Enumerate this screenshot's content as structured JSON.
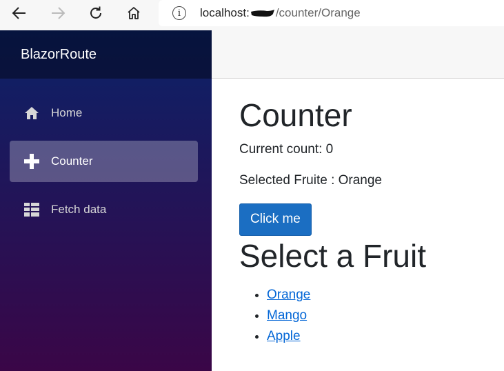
{
  "browser": {
    "url_host": "localhost:",
    "url_path": "/counter/Orange"
  },
  "sidebar": {
    "brand": "BlazorRoute",
    "items": [
      {
        "label": "Home",
        "icon": "home-icon",
        "active": false
      },
      {
        "label": "Counter",
        "icon": "plus-icon",
        "active": true
      },
      {
        "label": "Fetch data",
        "icon": "list-icon",
        "active": false
      }
    ]
  },
  "main": {
    "title": "Counter",
    "current_count_text": "Current count: 0",
    "selected_text": "Selected Fruite : Orange",
    "button_label": "Click me",
    "section_title": "Select a Fruit",
    "fruits": [
      "Orange",
      "Mango",
      "Apple"
    ]
  },
  "colors": {
    "button": "#1b6ec2",
    "link": "#0366d6",
    "sidebar_top": "#0b2268",
    "sidebar_bottom": "#3a0647"
  }
}
